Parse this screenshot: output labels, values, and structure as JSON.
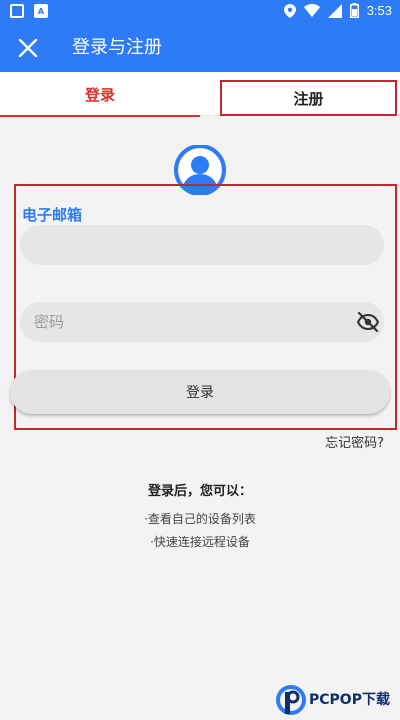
{
  "status_bar": {
    "time": "3:53"
  },
  "app_bar": {
    "title": "登录与注册"
  },
  "tabs": [
    {
      "label": "登录",
      "selected": true
    },
    {
      "label": "注册",
      "selected": false
    }
  ],
  "form": {
    "email_label": "电子邮箱",
    "email_value": "",
    "password_placeholder": "密码",
    "login_button": "登录",
    "forgot_password": "忘记密码?"
  },
  "info": {
    "title": "登录后，您可以：",
    "items": [
      "·查看自己的设备列表",
      "·快速连接远程设备"
    ]
  },
  "watermark": {
    "brand": "PCPOP下载"
  },
  "colors": {
    "primary": "#2d7cf6",
    "accent_red": "#e0302e",
    "highlight_frame": "#c1272d"
  }
}
